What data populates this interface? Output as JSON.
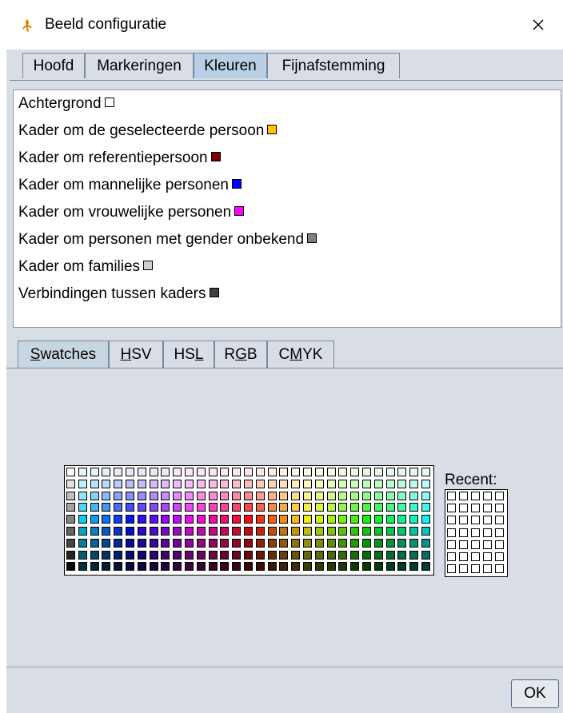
{
  "window": {
    "title": "Beeld configuratie",
    "app_icon": "gecko-icon",
    "close_icon": "close-icon"
  },
  "main_tabs": [
    {
      "label": "Hoofd",
      "active": false
    },
    {
      "label": "Markeringen",
      "active": false
    },
    {
      "label": "Kleuren",
      "active": true
    },
    {
      "label": "Fijnafstemming",
      "active": false
    }
  ],
  "color_items": [
    {
      "label": "Achtergrond",
      "color": "#ffffff"
    },
    {
      "label": "Kader om de geselecteerde persoon",
      "color": "#ffc000"
    },
    {
      "label": "Kader om referentiepersoon",
      "color": "#7a0000"
    },
    {
      "label": "Kader om mannelijke personen",
      "color": "#0000ff"
    },
    {
      "label": "Kader om vrouwelijke personen",
      "color": "#ff00ff"
    },
    {
      "label": "Kader om personen met gender onbekend",
      "color": "#808080"
    },
    {
      "label": "Kader om families",
      "color": "#d0d0d0"
    },
    {
      "label": "Verbindingen tussen kaders",
      "color": "#404040"
    }
  ],
  "chooser_tabs": [
    {
      "pre": "",
      "mn": "S",
      "post": "watches",
      "active": true
    },
    {
      "pre": "",
      "mn": "H",
      "post": "SV",
      "active": false
    },
    {
      "pre": "HS",
      "mn": "L",
      "post": "",
      "active": false
    },
    {
      "pre": "R",
      "mn": "G",
      "post": "B",
      "active": false
    },
    {
      "pre": "C",
      "mn": "M",
      "post": "YK",
      "active": false
    }
  ],
  "recent_label": "Recent:",
  "ok_label": "OK"
}
